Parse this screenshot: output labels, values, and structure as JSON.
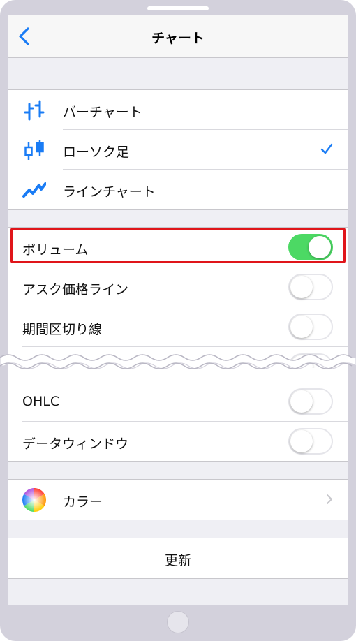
{
  "nav": {
    "title": "チャート",
    "back_icon": "chevron-left-icon"
  },
  "chart_types": [
    {
      "label": "バーチャート",
      "icon": "bar-chart-icon",
      "selected": false
    },
    {
      "label": "ローソク足",
      "icon": "candlestick-icon",
      "selected": true
    },
    {
      "label": "ラインチャート",
      "icon": "line-chart-icon",
      "selected": false
    }
  ],
  "toggles_top": [
    {
      "label": "ボリューム",
      "on": true
    },
    {
      "label": "アスク価格ライン",
      "on": false
    },
    {
      "label": "期間区切り線",
      "on": false
    }
  ],
  "toggles_bottom": [
    {
      "label": "OHLC",
      "on": false
    },
    {
      "label": "データウィンドウ",
      "on": false
    }
  ],
  "color_row": {
    "label": "カラー",
    "icon": "color-wheel-icon"
  },
  "update_button": {
    "label": "更新"
  },
  "colors": {
    "accent": "#1a7cf5",
    "toggle_on": "#4cd964",
    "highlight": "#e0151a"
  }
}
